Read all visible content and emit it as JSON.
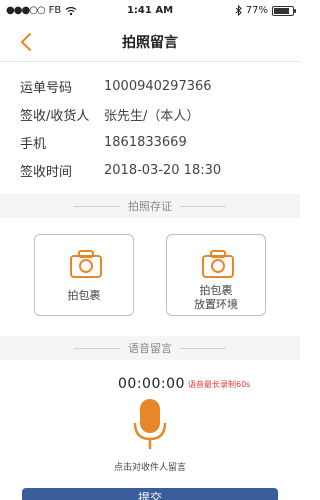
{
  "status_bar": {
    "carrier": "FB",
    "time": "1:41 AM",
    "battery_percent": "77%",
    "battery_level": 0.77
  },
  "header": {
    "title": "拍照留言",
    "back_icon": "chevron-left-icon",
    "accent_color": "#e8862a"
  },
  "info": {
    "rows": [
      {
        "label": "运单号码",
        "value": "1000940297366"
      },
      {
        "label": "签收/收货人",
        "value": "张先生/（本人）"
      },
      {
        "label": "手机",
        "value": "1861833669"
      },
      {
        "label": "签收时间",
        "value": "2018-03-20  18:30"
      }
    ]
  },
  "photo_section": {
    "title": "拍照存证",
    "cards": [
      {
        "label_line1": "拍包裹",
        "label_line2": "",
        "icon": "camera-icon"
      },
      {
        "label_line1": "拍包裹",
        "label_line2": "放置环境",
        "icon": "camera-icon"
      }
    ]
  },
  "voice_section": {
    "title": "语音留言",
    "timer": "00:00:00",
    "limit_note": "语音最长录制60s",
    "mic_icon": "microphone-icon",
    "hint": "点击对收件人留言"
  },
  "bottom_button": {
    "label": "提交"
  }
}
